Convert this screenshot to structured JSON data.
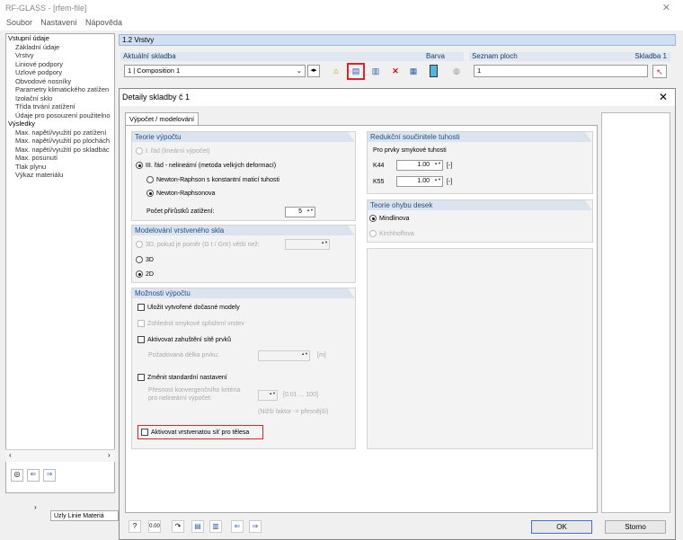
{
  "window": {
    "title": "RF-GLASS - [rfem-file]"
  },
  "menu": {
    "items": [
      "Soubor",
      "Nastavení",
      "Nápověda"
    ]
  },
  "nav": {
    "header": "Vstupní údaje",
    "items": [
      "Základní údaje",
      "Vrstvy",
      "Liniové podpory",
      "Uzlové podpory",
      "Obvodové nosníky",
      "Parametry klimatického zatížen",
      "Izolační sklo",
      "Třída trvání zatížení",
      "Údaje pro posouzení použitelno"
    ],
    "results_header": "Výsledky",
    "results": [
      "Max. napětí/využití po zatížení",
      "Max. napětí/využití po plochách",
      "Max. napětí/využití po skladbác",
      "Max. posunutí",
      "Tlak plynu",
      "Výkaz materiálu"
    ]
  },
  "section": {
    "title": "1.2 Vrstvy"
  },
  "layup": {
    "header": "Aktuální skladba",
    "value": "1 | Composition 1",
    "color_header": "Barva",
    "surfaces_header": "Seznam ploch",
    "surfaces_value": "1",
    "layup_label": "Skladba 1"
  },
  "dialog": {
    "title": "Detaily skladby č 1",
    "tab": "Výpočet / modelování",
    "theory": {
      "header": "Teorie výpočtu",
      "opt1": "I. řád (lineární výpočet)",
      "opt2": "III. řád - nelineární (metoda velkých deformací)",
      "opt2a": "Newton-Raphson s konstantní maticí tuhosti",
      "opt2b": "Newton-Raphsonova",
      "increments_label": "Počet přírůstků zatížení:",
      "increments_value": "5"
    },
    "model": {
      "header": "Modelování vrstveného skla",
      "opt_cond": "3D, pokud je poměr (G t / Grtr) větší než:",
      "opt3d": "3D",
      "opt2d": "2D"
    },
    "options": {
      "header": "Možnosti výpočtu",
      "c1": "Uložit vytvořené dočasné modely",
      "c2": "Zohlednit smykové spřažení vrstev",
      "c3": "Aktivovat zahuštění sítě prvků",
      "c3_sub": "Požadovaná délka prvku:",
      "c3_unit": "[m]",
      "c4": "Změnit standardní nastavení",
      "c4_sub1": "Přesnost konvergenčního kritéria",
      "c4_sub2": "pro nelineární výpočet:",
      "c4_range": "[0.01 ... 100]",
      "c4_hint": "(Nižší faktor -> přesnější)",
      "c5": "Aktivovat vrstvenatou síť pro tělesa"
    },
    "stiffness": {
      "header": "Redukční součinitele tuhosti",
      "sub": "Pro prvky smykové tuhosti",
      "k44_label": "K44",
      "k44_value": "1.00",
      "k55_label": "K55",
      "k55_value": "1.00",
      "unit": "[-]"
    },
    "plate": {
      "header": "Teorie ohybu desek",
      "opt1": "Mindlinova",
      "opt2": "Kirchhoffova"
    },
    "ok": "OK",
    "cancel": "Storno"
  },
  "bottom_tabs": "Uzly Linie Materiá"
}
